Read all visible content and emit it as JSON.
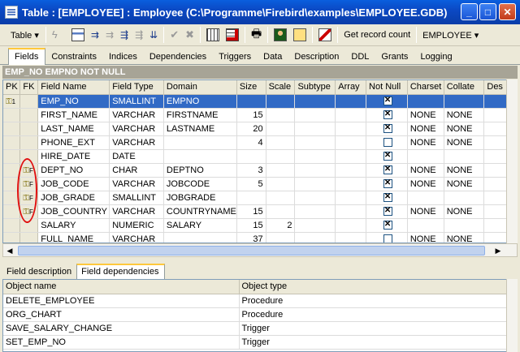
{
  "window": {
    "title": "Table : [EMPLOYEE] : Employee (C:\\Programme\\Firebird\\examples\\EMPLOYEE.GDB)"
  },
  "toolbar": {
    "table_label": "Table ▾",
    "record_count_label": "Get record count",
    "table_select_value": "EMPLOYEE ▾"
  },
  "tabs": [
    "Fields",
    "Constraints",
    "Indices",
    "Dependencies",
    "Triggers",
    "Data",
    "Description",
    "DDL",
    "Grants",
    "Logging"
  ],
  "primary_key_header": "EMP_NO EMPNO NOT NULL",
  "fields": {
    "columns": [
      "PK",
      "FK",
      "Field Name",
      "Field Type",
      "Domain",
      "Size",
      "Scale",
      "Subtype",
      "Array",
      "Not Null",
      "Charset",
      "Collate",
      "Des"
    ],
    "rows": [
      {
        "pk": "1",
        "fk": "",
        "name": "EMP_NO",
        "type": "SMALLINT",
        "domain": "EMPNO",
        "size": "",
        "scale": "",
        "notnull": true,
        "charset": "",
        "collate": ""
      },
      {
        "pk": "",
        "fk": "",
        "name": "FIRST_NAME",
        "type": "VARCHAR",
        "domain": "FIRSTNAME",
        "size": "15",
        "scale": "",
        "notnull": true,
        "charset": "NONE",
        "collate": "NONE"
      },
      {
        "pk": "",
        "fk": "",
        "name": "LAST_NAME",
        "type": "VARCHAR",
        "domain": "LASTNAME",
        "size": "20",
        "scale": "",
        "notnull": true,
        "charset": "NONE",
        "collate": "NONE"
      },
      {
        "pk": "",
        "fk": "",
        "name": "PHONE_EXT",
        "type": "VARCHAR",
        "domain": "",
        "size": "4",
        "scale": "",
        "notnull": false,
        "charset": "NONE",
        "collate": "NONE"
      },
      {
        "pk": "",
        "fk": "",
        "name": "HIRE_DATE",
        "type": "DATE",
        "domain": "",
        "size": "",
        "scale": "",
        "notnull": true,
        "charset": "",
        "collate": ""
      },
      {
        "pk": "",
        "fk": "F",
        "name": "DEPT_NO",
        "type": "CHAR",
        "domain": "DEPTNO",
        "size": "3",
        "scale": "",
        "notnull": true,
        "charset": "NONE",
        "collate": "NONE"
      },
      {
        "pk": "",
        "fk": "F",
        "name": "JOB_CODE",
        "type": "VARCHAR",
        "domain": "JOBCODE",
        "size": "5",
        "scale": "",
        "notnull": true,
        "charset": "NONE",
        "collate": "NONE"
      },
      {
        "pk": "",
        "fk": "F",
        "name": "JOB_GRADE",
        "type": "SMALLINT",
        "domain": "JOBGRADE",
        "size": "",
        "scale": "",
        "notnull": true,
        "charset": "",
        "collate": ""
      },
      {
        "pk": "",
        "fk": "F",
        "name": "JOB_COUNTRY",
        "type": "VARCHAR",
        "domain": "COUNTRYNAME",
        "size": "15",
        "scale": "",
        "notnull": true,
        "charset": "NONE",
        "collate": "NONE"
      },
      {
        "pk": "",
        "fk": "",
        "name": "SALARY",
        "type": "NUMERIC",
        "domain": "SALARY",
        "size": "15",
        "scale": "2",
        "notnull": true,
        "charset": "",
        "collate": ""
      },
      {
        "pk": "",
        "fk": "",
        "name": "FULL_NAME",
        "type": "VARCHAR",
        "domain": "",
        "size": "37",
        "scale": "",
        "notnull": false,
        "charset": "NONE",
        "collate": "NONE"
      }
    ]
  },
  "bottom_tabs": [
    "Field description",
    "Field dependencies"
  ],
  "dependencies": {
    "columns": [
      "Object name",
      "Object type"
    ],
    "rows": [
      {
        "name": "DELETE_EMPLOYEE",
        "type": "Procedure"
      },
      {
        "name": "ORG_CHART",
        "type": "Procedure"
      },
      {
        "name": "SAVE_SALARY_CHANGE",
        "type": "Trigger"
      },
      {
        "name": "SET_EMP_NO",
        "type": "Trigger"
      }
    ]
  }
}
